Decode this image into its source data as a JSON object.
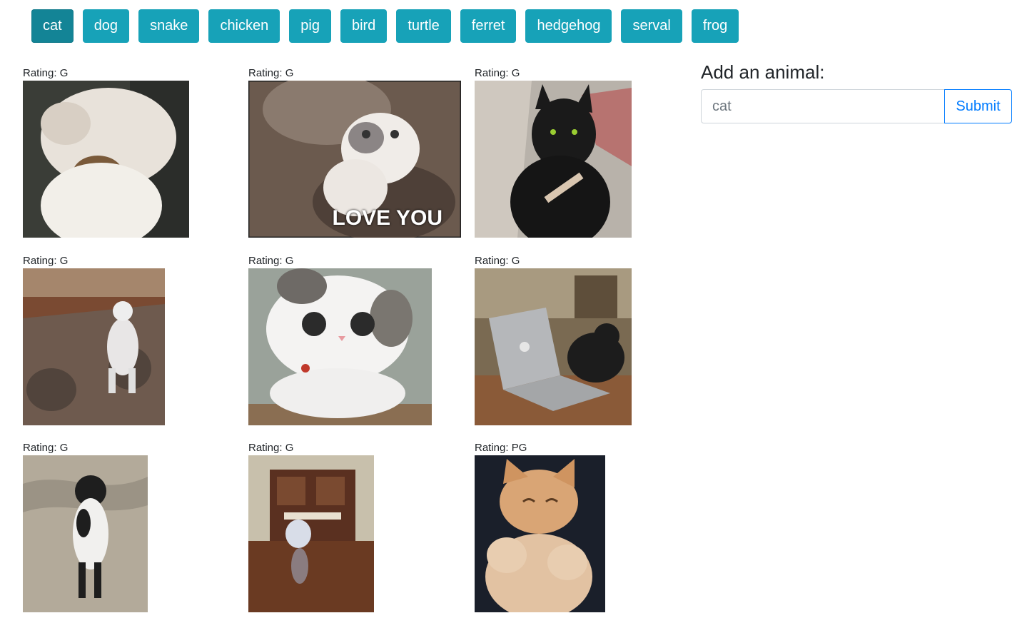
{
  "buttons": [
    "cat",
    "dog",
    "snake",
    "chicken",
    "pig",
    "bird",
    "turtle",
    "ferret",
    "hedgehog",
    "serval",
    "frog"
  ],
  "active_button": "cat",
  "gifs": [
    {
      "rating": "Rating: G",
      "icon": "fluffy-cat-gif"
    },
    {
      "rating": "Rating: G",
      "icon": "love-you-cat-gif",
      "overlay_text": "LOVE YOU"
    },
    {
      "rating": "Rating: G",
      "icon": "black-cat-nail-file-gif"
    },
    {
      "rating": "Rating: G",
      "icon": "dancing-white-cat-gif"
    },
    {
      "rating": "Rating: G",
      "icon": "big-eyed-cat-gif"
    },
    {
      "rating": "Rating: G",
      "icon": "cat-laptop-gif"
    },
    {
      "rating": "Rating: G",
      "icon": "standing-cat-gif"
    },
    {
      "rating": "Rating: G",
      "icon": "cat-kitchen-floor-gif"
    },
    {
      "rating": "Rating: PG",
      "icon": "orange-kitten-gif"
    }
  ],
  "add_form": {
    "title": "Add an animal:",
    "placeholder": "cat",
    "submit_label": "Submit"
  },
  "colors": {
    "button_bg": "#17a2b8",
    "button_active_bg": "#138496",
    "submit_border": "#007bff"
  }
}
